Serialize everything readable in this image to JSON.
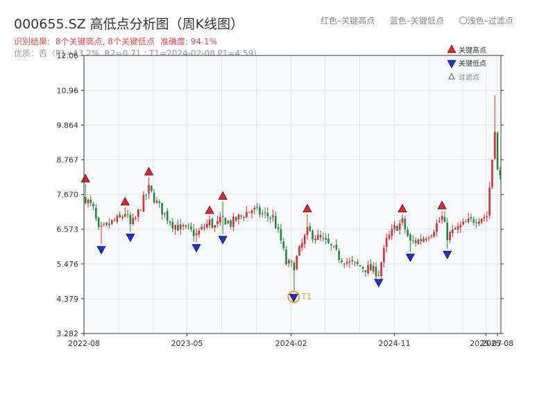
{
  "header": {
    "title": "000655.SZ 高低点分析图（周K线图）",
    "legend_high": "红色–关键高点",
    "legend_low": "蓝色–关键低点",
    "legend_filtered": "〇浅色–过滤点",
    "result_prefix": "识别结果:",
    "result_counts": "8个关键高点, 8个关键低点",
    "accuracy": "准确度: 94.1%",
    "quality": "优质：否（P1=43.2%, R2=0.71 ; T1=2024-02-08 P1=4.59）"
  },
  "chart_data": {
    "type": "candlestick",
    "title": "000655.SZ 高低点分析图（周K线图）",
    "x_tick_labels": [
      "2022-08",
      "2023-05",
      "2024-02",
      "2024-11",
      "2025-07",
      "2025-08"
    ],
    "x_ticks": [
      "2022-08",
      "2023-05",
      "2024-02",
      "2024-11",
      "2025-07",
      "2025-08"
    ],
    "y_ticks": [
      3.282,
      4.379,
      5.476,
      6.573,
      7.67,
      8.767,
      9.864,
      10.96,
      12.06
    ],
    "ylim": [
      3.282,
      12.06
    ],
    "x_range": [
      "2022-08",
      "2025-08"
    ],
    "grid": true,
    "legend_position": "top-right",
    "legend": [
      "关键高点",
      "关键低点",
      "过滤点"
    ],
    "colors": {
      "up": "#e0292d",
      "down": "#1b8a3a",
      "high_marker": "#e8232b",
      "low_marker": "#1f2fd0",
      "t1": "#f0a030",
      "plot_bg": "#f7f8fa"
    },
    "high_points": [
      {
        "date": "2022-08-05",
        "value": 8.0
      },
      {
        "date": "2022-11-18",
        "value": 7.27
      },
      {
        "date": "2023-01-20",
        "value": 8.22
      },
      {
        "date": "2023-06-30",
        "value": 7.0
      },
      {
        "date": "2023-08-04",
        "value": 7.45
      },
      {
        "date": "2024-03-15",
        "value": 7.05
      },
      {
        "date": "2024-11-22",
        "value": 7.05
      },
      {
        "date": "2025-03-07",
        "value": 7.15
      }
    ],
    "low_points": [
      {
        "date": "2022-09-16",
        "value": 6.1
      },
      {
        "date": "2022-12-02",
        "value": 6.49
      },
      {
        "date": "2023-05-26",
        "value": 6.16
      },
      {
        "date": "2023-08-04",
        "value": 6.42
      },
      {
        "date": "2024-02-08",
        "value": 4.59
      },
      {
        "date": "2024-09-20",
        "value": 5.06
      },
      {
        "date": "2024-12-13",
        "value": 5.86
      },
      {
        "date": "2025-03-21",
        "value": 5.95
      }
    ],
    "t1": {
      "label": "T1",
      "date": "2024-02-08",
      "value": 4.59
    },
    "close_path": [
      [
        "2022-08-05",
        7.55
      ],
      [
        "2022-08-26",
        7.2
      ],
      [
        "2022-09-09",
        6.5
      ],
      [
        "2022-09-23",
        6.6
      ],
      [
        "2022-10-14",
        6.8
      ],
      [
        "2022-11-04",
        6.9
      ],
      [
        "2022-11-18",
        7.1
      ],
      [
        "2022-12-02",
        6.7
      ],
      [
        "2022-12-16",
        6.9
      ],
      [
        "2023-01-06",
        7.5
      ],
      [
        "2023-01-20",
        7.85
      ],
      [
        "2023-02-10",
        7.4
      ],
      [
        "2023-03-03",
        7.05
      ],
      [
        "2023-03-24",
        6.75
      ],
      [
        "2023-04-14",
        6.6
      ],
      [
        "2023-05-05",
        6.55
      ],
      [
        "2023-05-26",
        6.4
      ],
      [
        "2023-06-16",
        6.65
      ],
      [
        "2023-06-30",
        6.8
      ],
      [
        "2023-07-14",
        6.65
      ],
      [
        "2023-08-04",
        6.9
      ],
      [
        "2023-08-25",
        6.75
      ],
      [
        "2023-09-22",
        7.0
      ],
      [
        "2023-10-20",
        7.2
      ],
      [
        "2023-11-17",
        7.05
      ],
      [
        "2023-12-15",
        6.95
      ],
      [
        "2024-01-05",
        6.2
      ],
      [
        "2024-01-19",
        5.5
      ],
      [
        "2024-02-08",
        5.4
      ],
      [
        "2024-02-23",
        5.9
      ],
      [
        "2024-03-15",
        6.5
      ],
      [
        "2024-04-05",
        6.35
      ],
      [
        "2024-04-26",
        6.2
      ],
      [
        "2024-05-17",
        6.0
      ],
      [
        "2024-06-07",
        5.7
      ],
      [
        "2024-07-05",
        5.5
      ],
      [
        "2024-08-02",
        5.4
      ],
      [
        "2024-08-30",
        5.3
      ],
      [
        "2024-09-20",
        5.2
      ],
      [
        "2024-10-11",
        6.2
      ],
      [
        "2024-11-01",
        6.6
      ],
      [
        "2024-11-22",
        6.8
      ],
      [
        "2024-12-13",
        6.15
      ],
      [
        "2025-01-10",
        6.25
      ],
      [
        "2025-02-07",
        6.5
      ],
      [
        "2025-03-07",
        6.95
      ],
      [
        "2025-03-21",
        6.35
      ],
      [
        "2025-04-18",
        6.6
      ],
      [
        "2025-05-16",
        6.8
      ],
      [
        "2025-06-13",
        6.95
      ],
      [
        "2025-07-04",
        7.0
      ],
      [
        "2025-07-18",
        8.8
      ],
      [
        "2025-07-25",
        9.8
      ],
      [
        "2025-08-01",
        8.4
      ],
      [
        "2025-08-08",
        8.2
      ]
    ],
    "spike": {
      "date": "2025-07-25",
      "high": 10.8
    }
  }
}
